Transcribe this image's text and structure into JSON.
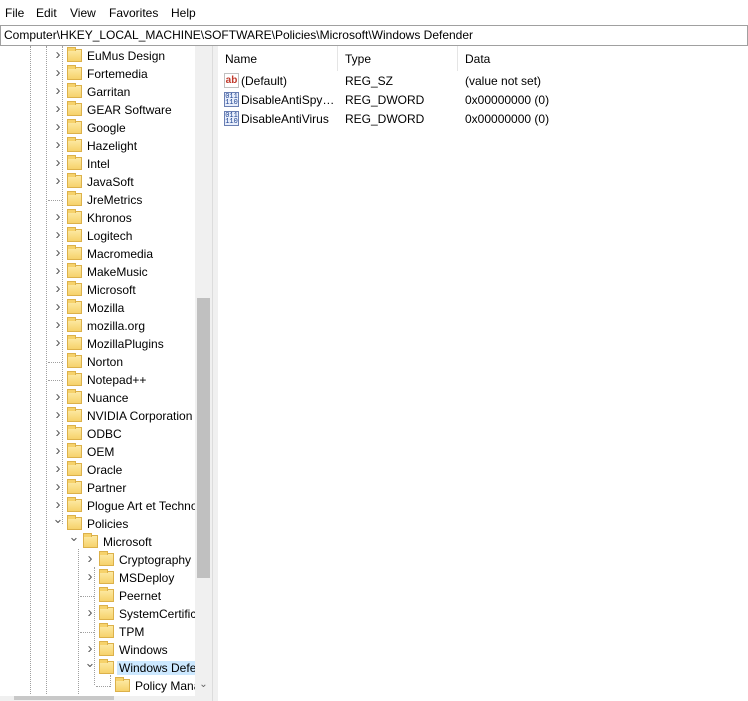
{
  "menu": {
    "file": "File",
    "edit": "Edit",
    "view": "View",
    "favorites": "Favorites",
    "help": "Help"
  },
  "address": "Computer\\HKEY_LOCAL_MACHINE\\SOFTWARE\\Policies\\Microsoft\\Windows Defender",
  "tree": {
    "items": [
      {
        "label": "EuMus Design",
        "expander": "collapsed"
      },
      {
        "label": "Fortemedia",
        "expander": "collapsed"
      },
      {
        "label": "Garritan",
        "expander": "collapsed"
      },
      {
        "label": "GEAR Software",
        "expander": "collapsed"
      },
      {
        "label": "Google",
        "expander": "collapsed"
      },
      {
        "label": "Hazelight",
        "expander": "collapsed"
      },
      {
        "label": "Intel",
        "expander": "collapsed"
      },
      {
        "label": "JavaSoft",
        "expander": "collapsed"
      },
      {
        "label": "JreMetrics",
        "expander": "none"
      },
      {
        "label": "Khronos",
        "expander": "collapsed"
      },
      {
        "label": "Logitech",
        "expander": "collapsed"
      },
      {
        "label": "Macromedia",
        "expander": "collapsed"
      },
      {
        "label": "MakeMusic",
        "expander": "collapsed"
      },
      {
        "label": "Microsoft",
        "expander": "collapsed"
      },
      {
        "label": "Mozilla",
        "expander": "collapsed"
      },
      {
        "label": "mozilla.org",
        "expander": "collapsed"
      },
      {
        "label": "MozillaPlugins",
        "expander": "collapsed"
      },
      {
        "label": "Norton",
        "expander": "none"
      },
      {
        "label": "Notepad++",
        "expander": "none"
      },
      {
        "label": "Nuance",
        "expander": "collapsed"
      },
      {
        "label": "NVIDIA Corporation",
        "expander": "collapsed"
      },
      {
        "label": "ODBC",
        "expander": "collapsed"
      },
      {
        "label": "OEM",
        "expander": "collapsed"
      },
      {
        "label": "Oracle",
        "expander": "collapsed"
      },
      {
        "label": "Partner",
        "expander": "collapsed"
      },
      {
        "label": "Plogue Art et Techno",
        "expander": "collapsed"
      },
      {
        "label": "Policies",
        "expander": "expanded"
      }
    ],
    "microsoft": {
      "label": "Microsoft",
      "expander": "expanded"
    },
    "microsoft_children": [
      {
        "label": "Cryptography",
        "expander": "collapsed"
      },
      {
        "label": "MSDeploy",
        "expander": "collapsed"
      },
      {
        "label": "Peernet",
        "expander": "none"
      },
      {
        "label": "SystemCertificates",
        "expander": "collapsed"
      },
      {
        "label": "TPM",
        "expander": "none"
      },
      {
        "label": "Windows",
        "expander": "collapsed"
      },
      {
        "label": "Windows Defender",
        "expander": "expanded",
        "selected": true
      }
    ],
    "defender_child": {
      "label": "Policy Manager",
      "expander": "none"
    }
  },
  "scroll_icons": {
    "up": "chevron-up-icon",
    "down": "chevron-down-icon"
  },
  "list": {
    "columns": {
      "name": "Name",
      "type": "Type",
      "data": "Data"
    },
    "rows": [
      {
        "icon": "string-value-icon",
        "icon_text": "ab",
        "name": "(Default)",
        "type": "REG_SZ",
        "data": "(value not set)"
      },
      {
        "icon": "dword-value-icon",
        "icon_text": "011\n110",
        "name": "DisableAntiSpyware",
        "type": "REG_DWORD",
        "data": "0x00000000 (0)"
      },
      {
        "icon": "dword-value-icon",
        "icon_text": "011\n110",
        "name": "DisableAntiVirus",
        "type": "REG_DWORD",
        "data": "0x00000000 (0)"
      }
    ]
  },
  "colors": {
    "selection": "#cce8ff",
    "folder": "#f6d26b",
    "scrollbar": "#f0f0f0"
  }
}
